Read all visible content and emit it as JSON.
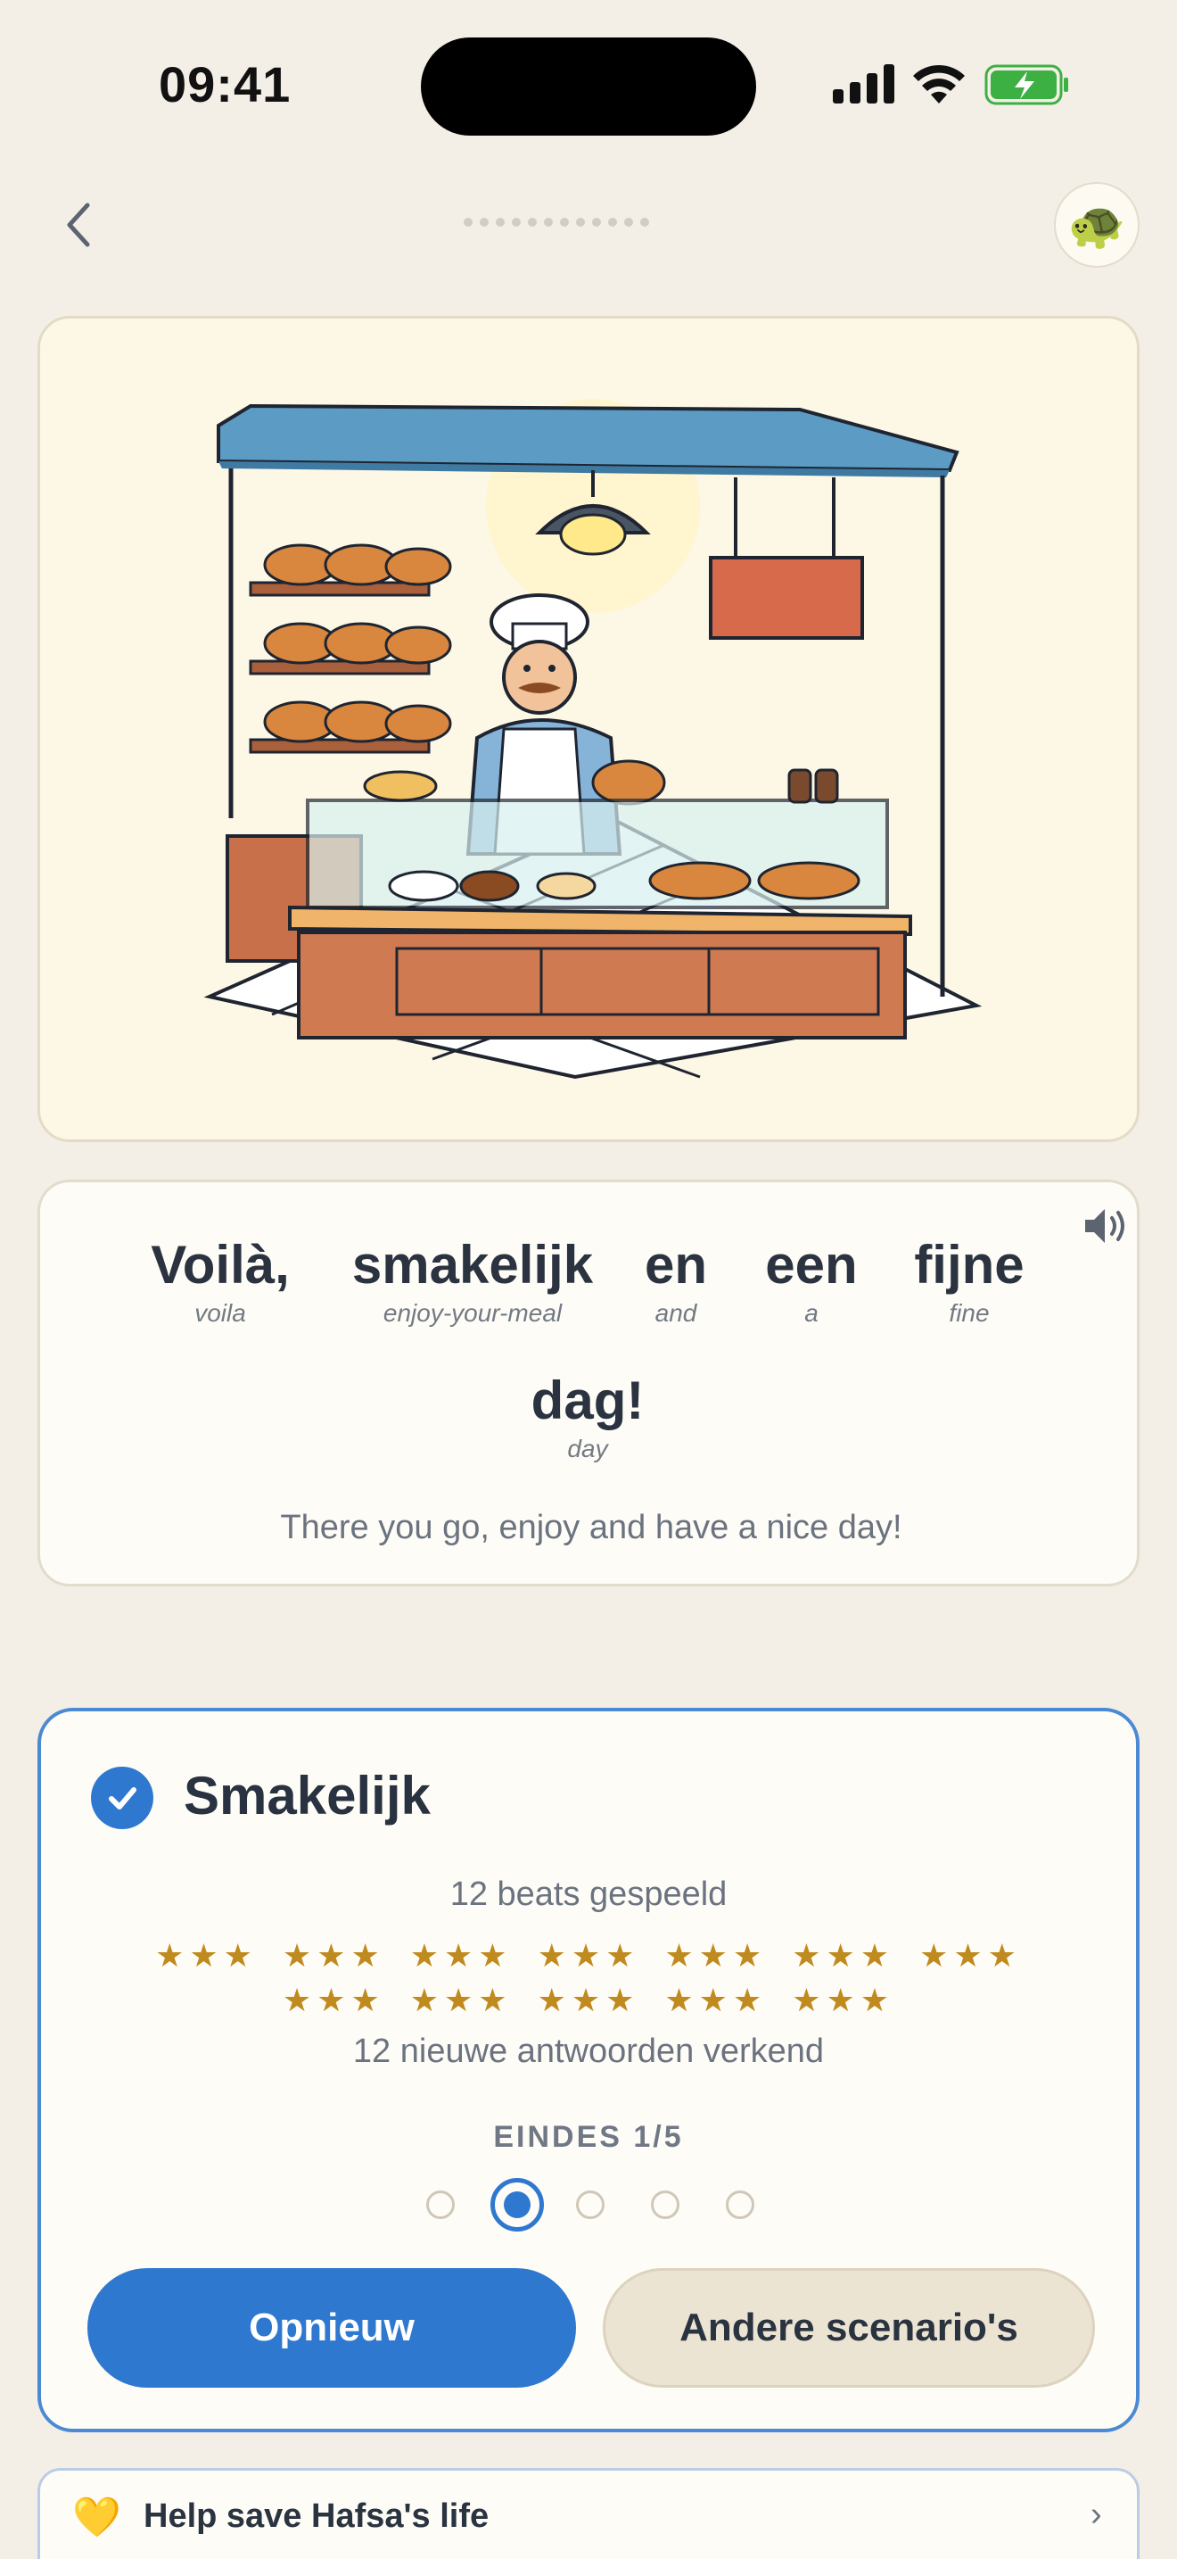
{
  "status_bar": {
    "time": "09:41"
  },
  "header": {
    "progress_steps": 12,
    "avatar_emoji": "🐢"
  },
  "illustration": {
    "subject": "bakery-counter-scene"
  },
  "phrase": {
    "words": [
      {
        "word": "Voilà,",
        "gloss": "voila"
      },
      {
        "word": "smakelijk",
        "gloss": "enjoy-your-meal"
      },
      {
        "word": "en",
        "gloss": "and"
      },
      {
        "word": "een",
        "gloss": "a"
      },
      {
        "word": "fijne",
        "gloss": "fine"
      },
      {
        "word": "dag!",
        "gloss": "day"
      }
    ],
    "translation": "There you go, enjoy and have a nice day!"
  },
  "result": {
    "title": "Smakelijk",
    "beats_text": "12 beats gespeeld",
    "stars_rows": [
      [
        "★★★",
        "★★★",
        "★★★",
        "★★★",
        "★★★",
        "★★★",
        "★★★"
      ],
      [
        "★★★",
        "★★★",
        "★★★",
        "★★★",
        "★★★"
      ]
    ],
    "answers_text": "12 nieuwe antwoorden verkend",
    "endings_label": "EINDES 1/5",
    "endings_total": 5,
    "endings_selected": 2,
    "retry_label": "Opnieuw",
    "other_label": "Andere scenario's"
  },
  "banner": {
    "heart": "💛",
    "label": "Help save Hafsa's life",
    "chevron": "›"
  },
  "colors": {
    "accent": "#2f78d0",
    "star": "#c08a1e",
    "background": "#f4efe6"
  }
}
